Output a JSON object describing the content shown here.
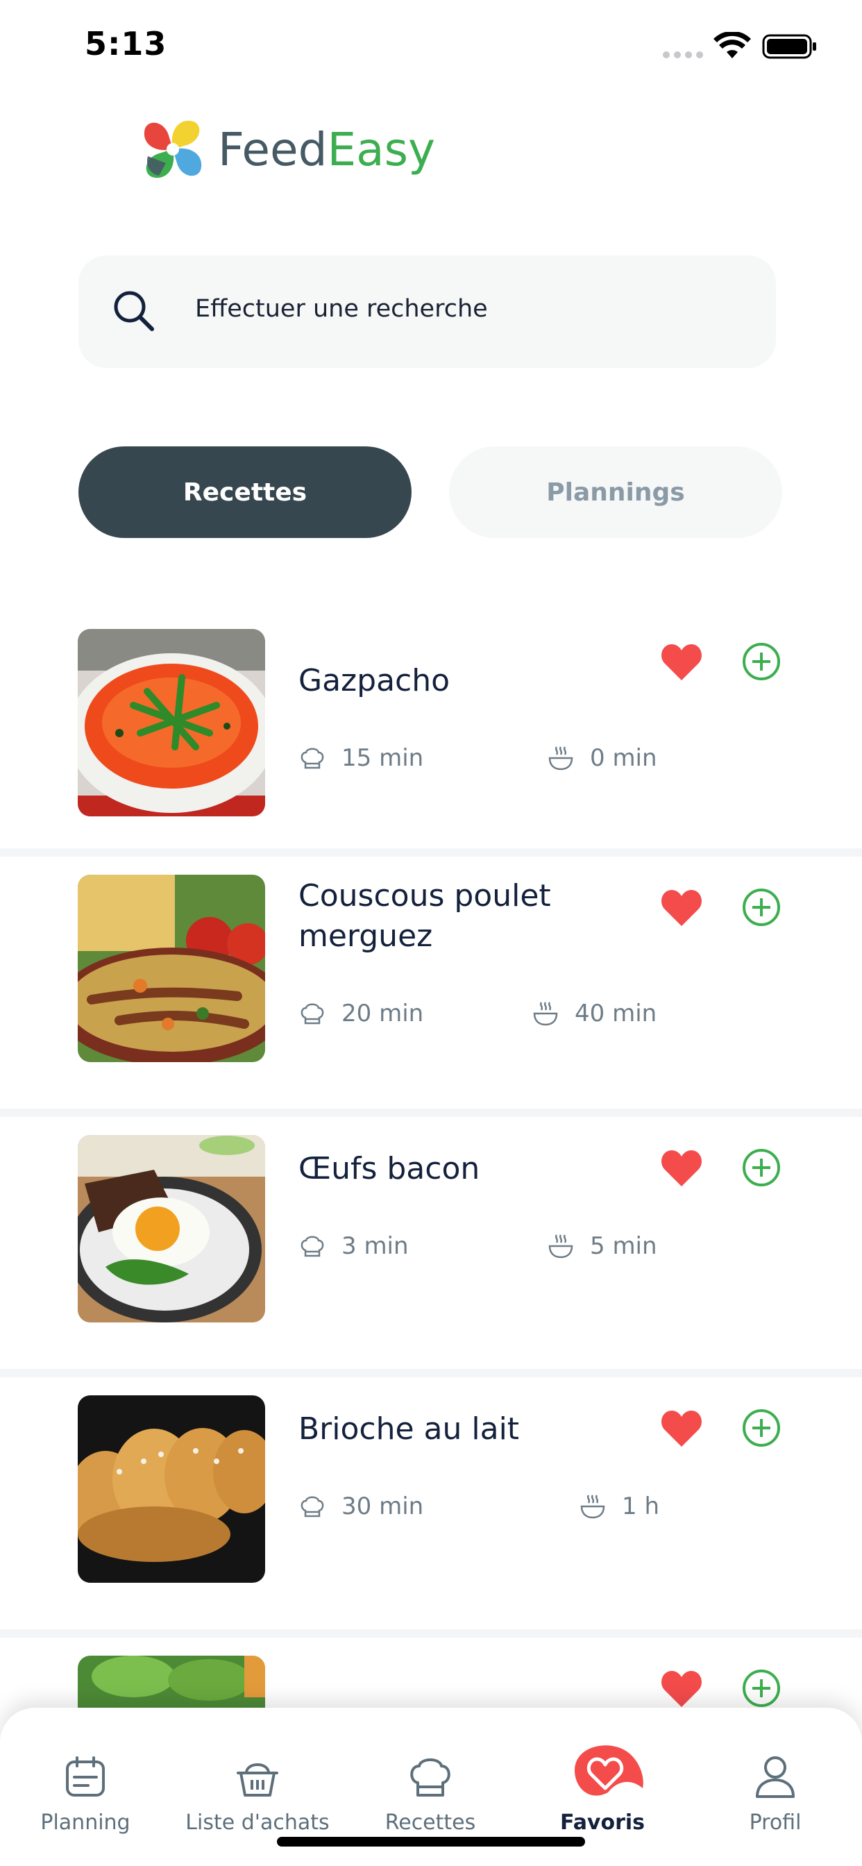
{
  "status_bar": {
    "time": "5:13"
  },
  "app": {
    "logo_part1": "Feed",
    "logo_part2": "Easy"
  },
  "search": {
    "placeholder": "Effectuer une recherche"
  },
  "tabs": [
    {
      "label": "Recettes",
      "active": true
    },
    {
      "label": "Plannings",
      "active": false
    }
  ],
  "recipes": [
    {
      "title": "Gazpacho",
      "prep_time": "15 min",
      "cook_time": "0 min",
      "favorite": true
    },
    {
      "title": "Couscous poulet merguez",
      "prep_time": "20 min",
      "cook_time": "40 min",
      "favorite": true
    },
    {
      "title": "Œufs bacon",
      "prep_time": "3 min",
      "cook_time": "5 min",
      "favorite": true
    },
    {
      "title": "Brioche au lait",
      "prep_time": "30 min",
      "cook_time": "1 h",
      "favorite": true
    }
  ],
  "bottom_nav": [
    {
      "label": "Planning",
      "icon": "calendar-icon",
      "active": false
    },
    {
      "label": "Liste d'achats",
      "icon": "basket-icon",
      "active": false
    },
    {
      "label": "Recettes",
      "icon": "chef-hat-icon",
      "active": false
    },
    {
      "label": "Favoris",
      "icon": "heart-icon",
      "active": true
    },
    {
      "label": "Profil",
      "icon": "user-icon",
      "active": false
    }
  ],
  "colors": {
    "accent_green": "#3dae4f",
    "dark_slate": "#37474f",
    "favorite_red": "#f44b4b",
    "search_bg": "#f6f7f7"
  }
}
